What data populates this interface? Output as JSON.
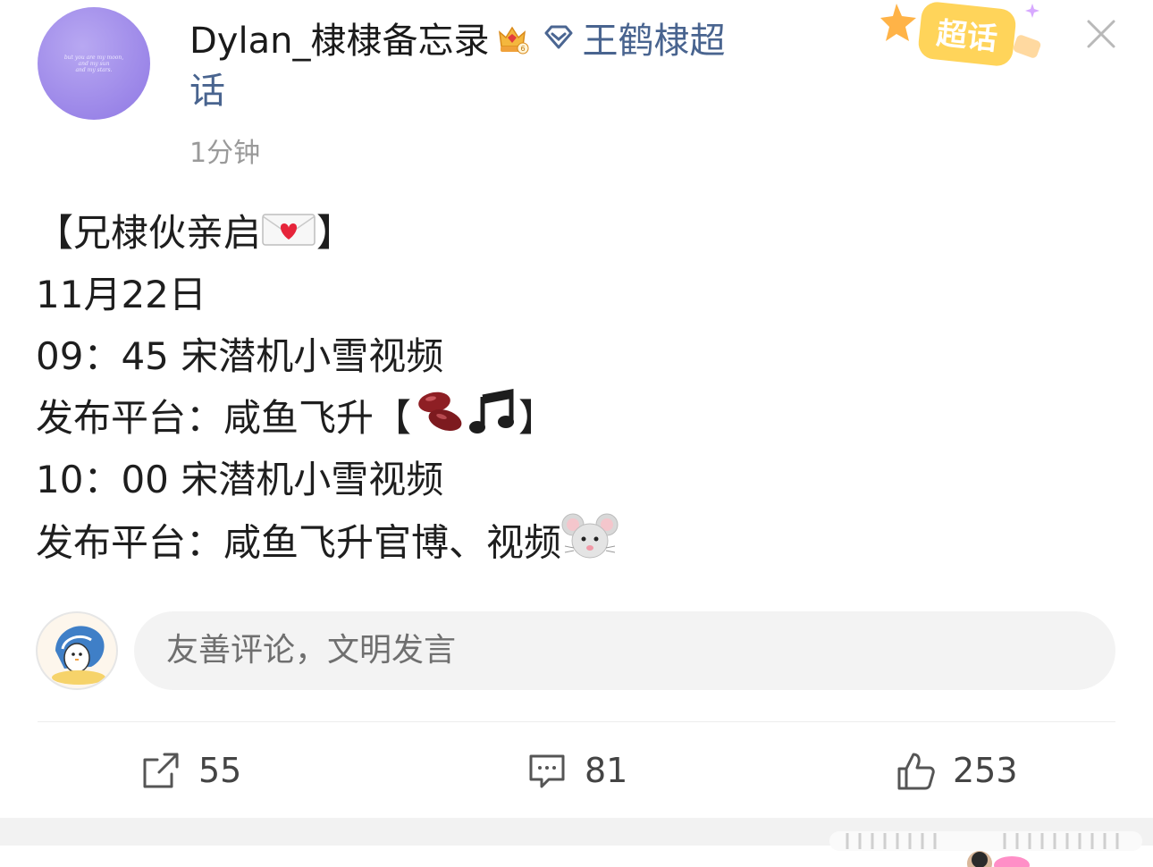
{
  "post": {
    "author": {
      "name": "Dylan_棣棣备忘录",
      "avatar_caption": [
        "but you are my moon,",
        "and my sun",
        "and my stars."
      ]
    },
    "topic": {
      "name_part1": "王鹤棣超",
      "name_part2": "话"
    },
    "timestamp": "1分钟",
    "super_topic_badge": "超话",
    "lines": [
      {
        "text": "【兄棣伙亲启",
        "emoji": "love-letter",
        "after": "】"
      },
      {
        "text": "11月22日"
      },
      {
        "text": "09：45 宋潜机小雪视频"
      },
      {
        "text": "发布平台：咸鱼飞升【",
        "emoji": "beans-music",
        "after": "】"
      },
      {
        "text": "10：00  宋潜机小雪视频"
      },
      {
        "text": "发布平台：咸鱼飞升官博、视频",
        "emoji": "mouse-face"
      }
    ]
  },
  "comment": {
    "placeholder": "友善评论，文明发言"
  },
  "actions": {
    "repost_count": "55",
    "comment_count": "81",
    "like_count": "253"
  },
  "icons": {
    "repost": "share-square-icon",
    "comment": "comment-bubble-icon",
    "like": "thumbs-up-icon",
    "close": "close-icon",
    "crown": "crown-icon",
    "diamond": "diamond-icon"
  },
  "colors": {
    "topic_link": "#49648f",
    "timestamp": "#9a9a9a",
    "input_bg": "#f3f3f3"
  }
}
